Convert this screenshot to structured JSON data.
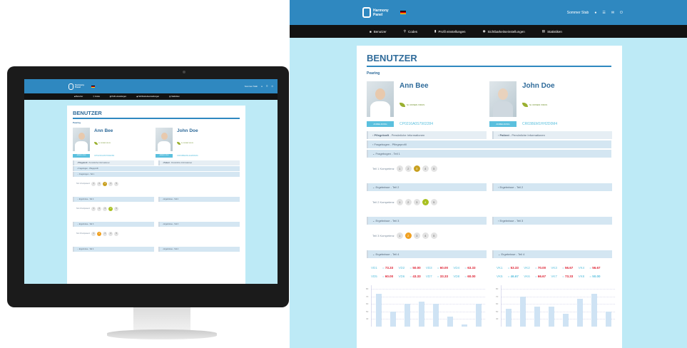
{
  "app": {
    "logo_line1": "Harmony",
    "logo_line2": "Panel",
    "user": "Sommer Stab",
    "nav": [
      {
        "label": "Benutzer",
        "icon": "user-icon"
      },
      {
        "label": "Codes",
        "icon": "key-icon"
      },
      {
        "label": "Profil einstellungen",
        "icon": "document-icon"
      },
      {
        "label": "Sichtbarkeitseinstellungen",
        "icon": "eye-icon"
      },
      {
        "label": "Statistiken",
        "icon": "chart-icon"
      }
    ]
  },
  "page": {
    "title": "BENUTZER",
    "subtitle": "Pearing"
  },
  "persons": [
    {
      "name": "Ann Bee",
      "pharmacy": "St. ROSEN VIDUS",
      "button": "ANMELDUNG",
      "code": "CP0216A0S7902284"
    },
    {
      "name": "John Doe",
      "pharmacy": "St. ROSEN VIDUS",
      "button": "ANMELDUNG",
      "code": "CR038EM1HH2D0M4"
    }
  ],
  "sections": {
    "pflege": "Pflegekraft",
    "pflege_sub": " - Persönliche Informationen",
    "patient": "Patient",
    "patient_sub": " - Persönliche Informationen",
    "frag_pflege": "Fragebogen - Pflegeprofil",
    "frag_teil1": "Fragebogen - Teil 1",
    "erg2": "Ergebnisse - Teil 2",
    "erg3": "Ergebnisse - Teil 3",
    "erg4": "Ergebnisse - Teil 4"
  },
  "kompetenz": [
    {
      "label": "Teil 1 Kompetenz",
      "values": [
        "1",
        "2",
        "3",
        "4",
        "5"
      ],
      "selected": 3
    },
    {
      "label": "Teil 2 Kompetenz",
      "values": [
        "1",
        "2",
        "3",
        "4",
        "5"
      ],
      "selected": 4
    },
    {
      "label": "Teil 3 Kompetenz",
      "values": [
        "1",
        "2",
        "3",
        "4",
        "5"
      ],
      "selected": 2
    }
  ],
  "vk_left": [
    {
      "k": "VD1",
      "v": "73.33"
    },
    {
      "k": "VD2",
      "v": "50.00"
    },
    {
      "k": "VD3",
      "v": "60.00"
    },
    {
      "k": "VD4",
      "v": "63.33"
    },
    {
      "k": "VD5",
      "v": "60.00"
    },
    {
      "k": "VD6",
      "v": "43.33"
    },
    {
      "k": "VD7",
      "v": "33.33"
    },
    {
      "k": "VD8",
      "v": "60.00"
    }
  ],
  "vk_right": [
    {
      "k": "VK1",
      "v": "53.33"
    },
    {
      "k": "VK2",
      "v": "70.00"
    },
    {
      "k": "VK3",
      "v": "56.67"
    },
    {
      "k": "VK4",
      "v": "56.67"
    },
    {
      "k": "VK5",
      "v": "46.67"
    },
    {
      "k": "VK6",
      "v": "66.67"
    },
    {
      "k": "VK7",
      "v": "73.33"
    },
    {
      "k": "VK8",
      "v": "50.00"
    }
  ],
  "chart_ticks": [
    "80",
    "70",
    "60",
    "50",
    "40"
  ],
  "colors": {
    "header": "#2f88c0",
    "nav": "#121212",
    "accent": "#5bc0de",
    "background": "#bdeaf6"
  }
}
